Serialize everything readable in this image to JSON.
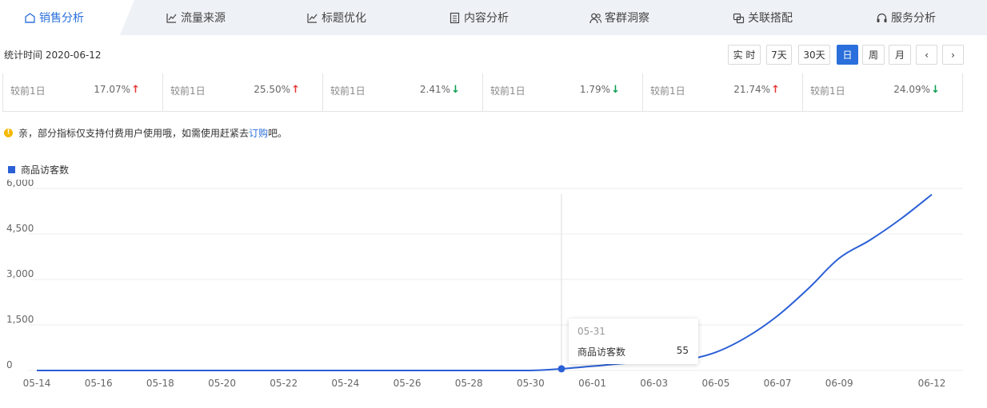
{
  "tabs": [
    {
      "label": "销售分析",
      "icon": "home-icon",
      "active": true
    },
    {
      "label": "流量来源",
      "icon": "line-chart-icon",
      "active": false
    },
    {
      "label": "标题优化",
      "icon": "line-chart-icon",
      "active": false
    },
    {
      "label": "内容分析",
      "icon": "document-icon",
      "active": false
    },
    {
      "label": "客群洞察",
      "icon": "users-icon",
      "active": false
    },
    {
      "label": "关联搭配",
      "icon": "link-icon",
      "active": false
    },
    {
      "label": "服务分析",
      "icon": "headset-icon",
      "active": false
    }
  ],
  "stat_time": "统计时间 2020-06-12",
  "range_buttons": [
    {
      "label": "实 时",
      "active": false
    },
    {
      "label": "7天",
      "active": false
    },
    {
      "label": "30天",
      "active": false
    },
    {
      "label": "日",
      "active": true
    },
    {
      "label": "周",
      "active": false
    },
    {
      "label": "月",
      "active": false
    },
    {
      "label": "‹",
      "active": false
    },
    {
      "label": "›",
      "active": false
    }
  ],
  "metrics": [
    {
      "label": "较前1日",
      "pct": "17.07%",
      "dir": "up"
    },
    {
      "label": "较前1日",
      "pct": "25.50%",
      "dir": "up"
    },
    {
      "label": "较前1日",
      "pct": "2.41%",
      "dir": "down"
    },
    {
      "label": "较前1日",
      "pct": "1.79%",
      "dir": "down"
    },
    {
      "label": "较前1日",
      "pct": "21.74%",
      "dir": "up"
    },
    {
      "label": "较前1日",
      "pct": "24.09%",
      "dir": "down"
    }
  ],
  "notice": {
    "text": "亲，部分指标仅支持付费用户使用哦，如需使用赶紧去 ",
    "link": "订购",
    "suffix": "吧。"
  },
  "colors": {
    "accent": "#2a6fdb",
    "line": "#2a5fd6",
    "up": "#e53935",
    "down": "#0b9e50"
  },
  "chart_data": {
    "type": "line",
    "legend": "商品访客数",
    "yticks": [
      "6,000",
      "4,500",
      "3,000",
      "1,500",
      "0"
    ],
    "ylim": [
      0,
      6000
    ],
    "xticks": [
      "05-14",
      "05-16",
      "05-18",
      "05-20",
      "05-22",
      "05-24",
      "05-26",
      "05-28",
      "05-30",
      "06-01",
      "06-03",
      "06-05",
      "06-07",
      "06-09",
      "06-12"
    ],
    "x": [
      "05-14",
      "05-15",
      "05-16",
      "05-17",
      "05-18",
      "05-19",
      "05-20",
      "05-21",
      "05-22",
      "05-23",
      "05-24",
      "05-25",
      "05-26",
      "05-27",
      "05-28",
      "05-29",
      "05-30",
      "05-31",
      "06-01",
      "06-02",
      "06-03",
      "06-04",
      "06-05",
      "06-06",
      "06-07",
      "06-08",
      "06-09",
      "06-10",
      "06-11",
      "06-12"
    ],
    "series": [
      {
        "name": "商品访客数",
        "values": [
          0,
          0,
          0,
          0,
          0,
          0,
          0,
          0,
          0,
          0,
          0,
          0,
          0,
          0,
          0,
          0,
          0,
          55,
          140,
          230,
          300,
          350,
          600,
          1100,
          1800,
          2700,
          3700,
          4300,
          5000,
          5800
        ]
      }
    ],
    "tooltip": {
      "date": "05-31",
      "name": "商品访客数",
      "value": "55"
    }
  }
}
